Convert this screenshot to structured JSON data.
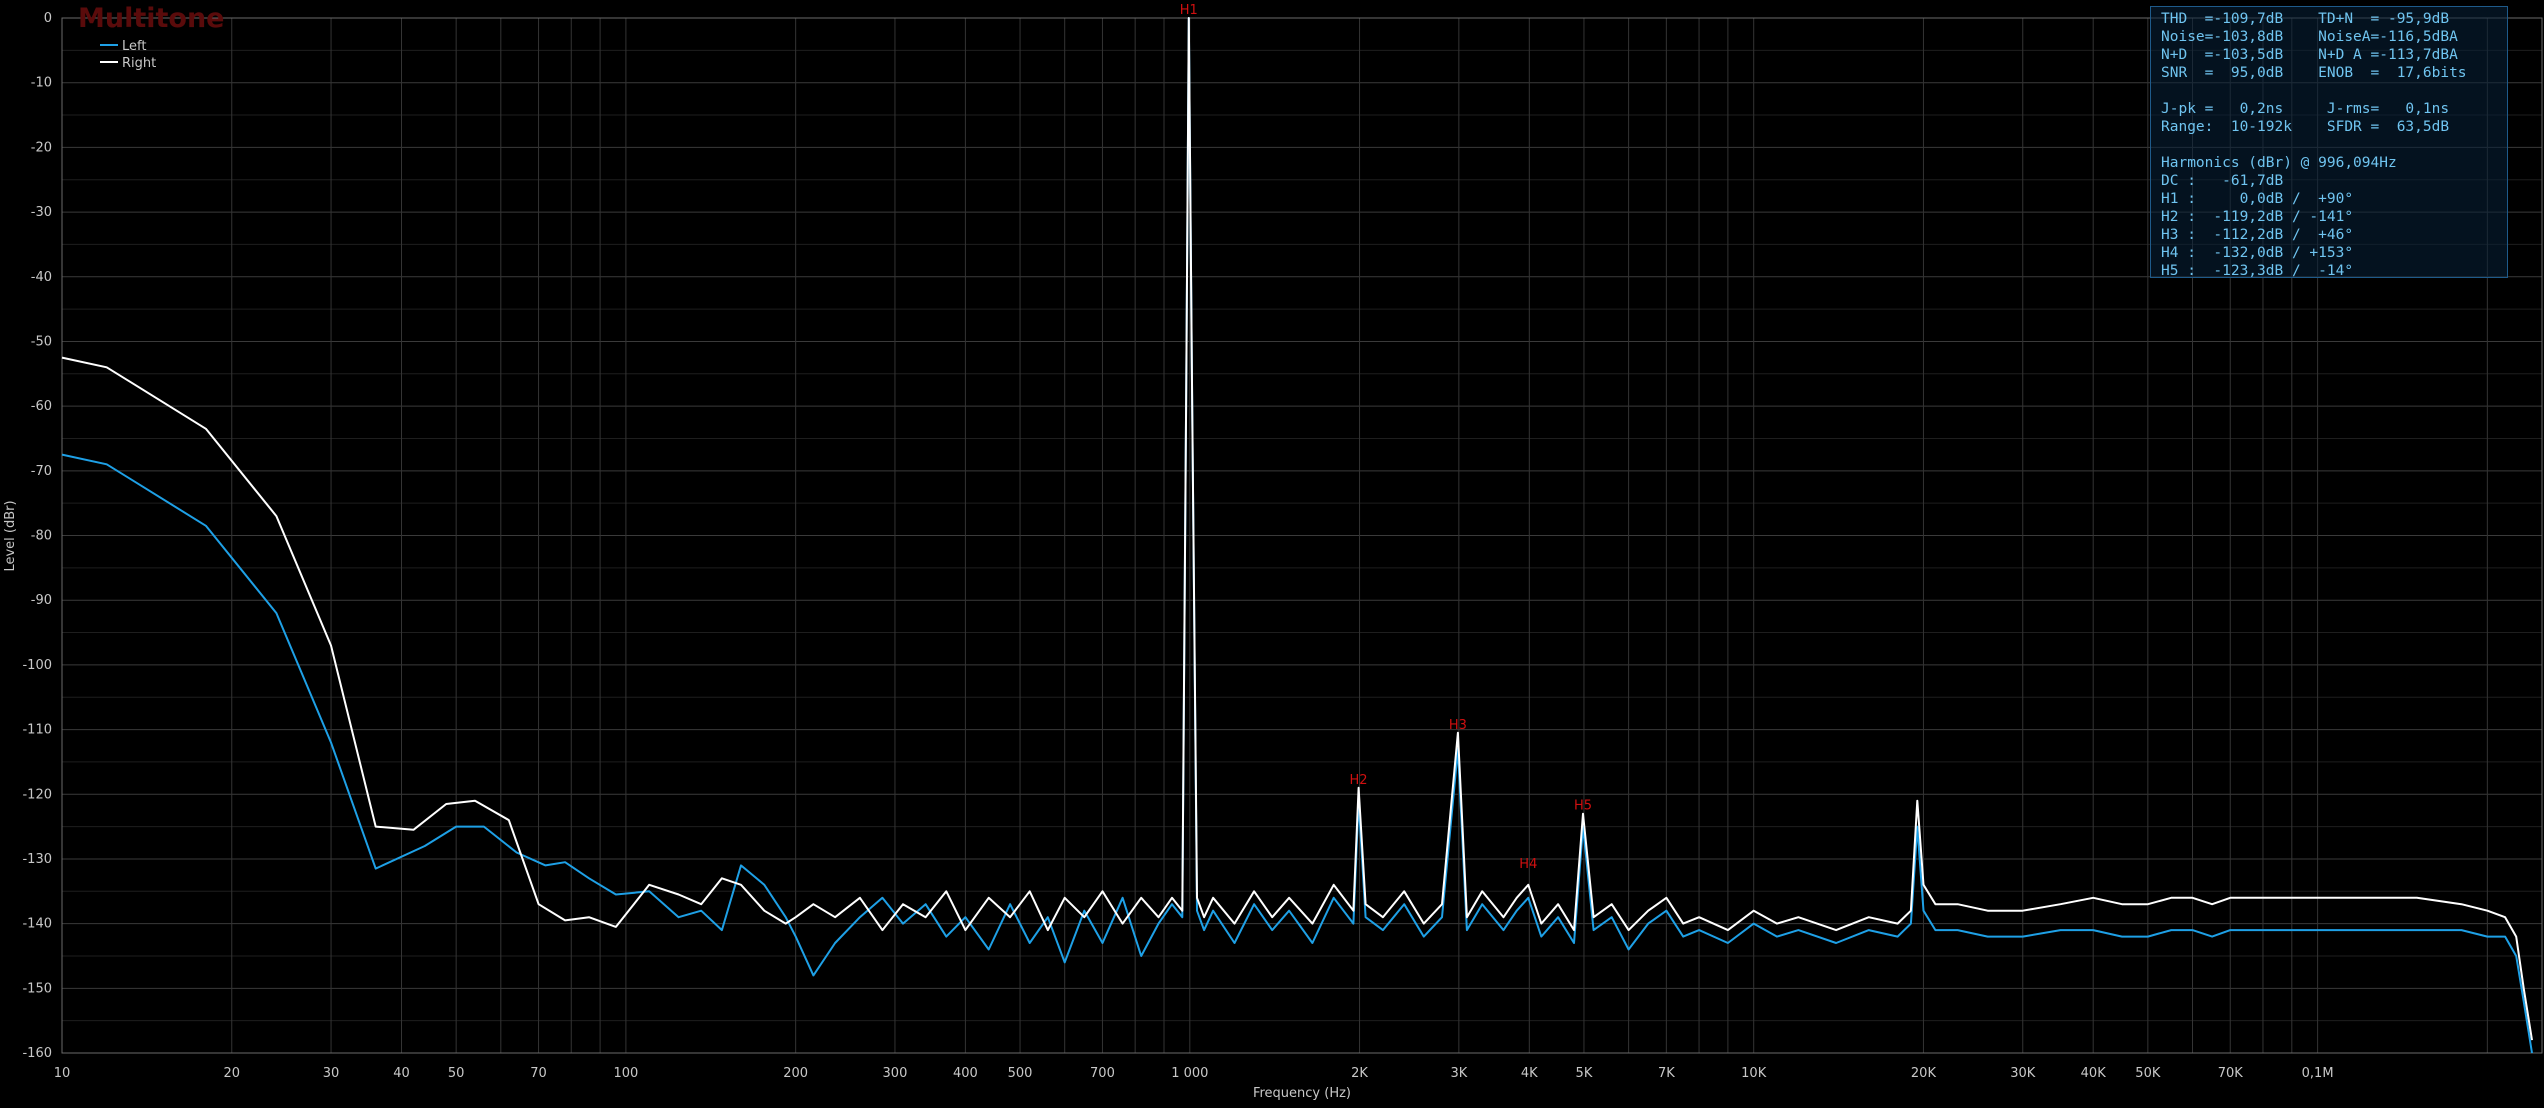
{
  "brand": "Multitone",
  "chart_data": {
    "type": "line",
    "xscale": "log",
    "xlim": [
      10,
      250000
    ],
    "ylim": [
      -160,
      0
    ],
    "xlabel": "Frequency (Hz)",
    "ylabel": "Level (dBr)",
    "grid": true,
    "legend_placement": "top-left",
    "y_ticks": [
      0,
      -10,
      -20,
      -30,
      -40,
      -50,
      -60,
      -70,
      -80,
      -90,
      -100,
      -110,
      -120,
      -130,
      -140,
      -150,
      -160
    ],
    "x_ticks": [
      {
        "value": 10,
        "label": "10"
      },
      {
        "value": 20,
        "label": "20"
      },
      {
        "value": 30,
        "label": "30"
      },
      {
        "value": 40,
        "label": "40"
      },
      {
        "value": 50,
        "label": "50"
      },
      {
        "value": 70,
        "label": "70"
      },
      {
        "value": 100,
        "label": "100"
      },
      {
        "value": 200,
        "label": "200"
      },
      {
        "value": 300,
        "label": "300"
      },
      {
        "value": 400,
        "label": "400"
      },
      {
        "value": 500,
        "label": "500"
      },
      {
        "value": 700,
        "label": "700"
      },
      {
        "value": 1000,
        "label": "1 000"
      },
      {
        "value": 2000,
        "label": "2K"
      },
      {
        "value": 3000,
        "label": "3K"
      },
      {
        "value": 4000,
        "label": "4K"
      },
      {
        "value": 5000,
        "label": "5K"
      },
      {
        "value": 7000,
        "label": "7K"
      },
      {
        "value": 10000,
        "label": "10K"
      },
      {
        "value": 20000,
        "label": "20K"
      },
      {
        "value": 30000,
        "label": "30K"
      },
      {
        "value": 40000,
        "label": "40K"
      },
      {
        "value": 50000,
        "label": "50K"
      },
      {
        "value": 70000,
        "label": "70K"
      },
      {
        "value": 100000,
        "label": "0,1M"
      }
    ],
    "series": [
      {
        "name": "Left",
        "color": "#1ea0e6",
        "x": [
          10,
          12,
          18,
          24,
          30,
          36,
          44,
          50,
          56,
          64,
          72,
          78,
          86,
          96,
          110,
          124,
          136,
          148,
          160,
          176,
          192,
          200,
          215,
          235,
          260,
          285,
          310,
          340,
          370,
          400,
          440,
          480,
          520,
          560,
          600,
          650,
          700,
          760,
          820,
          880,
          930,
          970,
          985,
          996,
          1010,
          1030,
          1060,
          1100,
          1200,
          1300,
          1400,
          1500,
          1650,
          1800,
          1950,
          1992,
          2050,
          2200,
          2400,
          2600,
          2800,
          2988,
          3100,
          3300,
          3600,
          3800,
          3984,
          4200,
          4500,
          4800,
          4980,
          5200,
          5600,
          6000,
          6500,
          7000,
          7500,
          8000,
          9000,
          10000,
          11000,
          12000,
          14000,
          16000,
          18000,
          19000,
          19500,
          20000,
          21000,
          23000,
          26000,
          30000,
          35000,
          40000,
          45000,
          50000,
          55000,
          60000,
          65000,
          70000,
          75000,
          80000,
          85000,
          90000,
          100000,
          120000,
          150000,
          180000,
          200000,
          215000,
          225000,
          232000,
          240000
        ],
        "y": [
          -67.5,
          -69,
          -78.5,
          -92,
          -112,
          -131.5,
          -128,
          -125,
          -125,
          -129,
          -131,
          -130.5,
          -133,
          -135.5,
          -135,
          -139,
          -138,
          -141,
          -131,
          -134,
          -139,
          -142,
          -148,
          -143,
          -139,
          -136,
          -140,
          -137,
          -142,
          -139,
          -144,
          -137,
          -143,
          -139,
          -146,
          -138,
          -143,
          -136,
          -145,
          -140,
          -137,
          -139,
          -60,
          0,
          -60,
          -138,
          -141,
          -138,
          -143,
          -137,
          -141,
          -138,
          -143,
          -136,
          -140,
          -121,
          -139,
          -141,
          -137,
          -142,
          -139,
          -113,
          -141,
          -137,
          -141,
          -138,
          -136,
          -142,
          -139,
          -143,
          -125,
          -141,
          -139,
          -144,
          -140,
          -138,
          -142,
          -141,
          -143,
          -140,
          -142,
          -141,
          -143,
          -141,
          -142,
          -140,
          -125,
          -138,
          -141,
          -141,
          -142,
          -142,
          -141,
          -141,
          -142,
          -142,
          -141,
          -141,
          -142,
          -141,
          -141,
          -141,
          -141,
          -141,
          -141,
          -141,
          -141,
          -141,
          -142,
          -142,
          -145,
          -152,
          -160
        ]
      },
      {
        "name": "Right",
        "color": "#ffffff",
        "x": [
          10,
          12,
          18,
          24,
          30,
          36,
          42,
          48,
          54,
          62,
          70,
          78,
          86,
          96,
          110,
          124,
          136,
          148,
          160,
          176,
          192,
          200,
          215,
          235,
          260,
          285,
          310,
          340,
          370,
          400,
          440,
          480,
          520,
          560,
          600,
          650,
          700,
          760,
          820,
          880,
          930,
          970,
          985,
          996,
          1010,
          1030,
          1060,
          1100,
          1200,
          1300,
          1400,
          1500,
          1650,
          1800,
          1950,
          1992,
          2050,
          2200,
          2400,
          2600,
          2800,
          2988,
          3100,
          3300,
          3600,
          3800,
          3984,
          4200,
          4500,
          4800,
          4980,
          5200,
          5600,
          6000,
          6500,
          7000,
          7500,
          8000,
          9000,
          10000,
          11000,
          12000,
          14000,
          16000,
          18000,
          19000,
          19500,
          20000,
          21000,
          23000,
          26000,
          30000,
          35000,
          40000,
          45000,
          50000,
          55000,
          60000,
          65000,
          70000,
          75000,
          80000,
          85000,
          90000,
          100000,
          120000,
          150000,
          180000,
          200000,
          215000,
          225000,
          232000,
          240000
        ],
        "y": [
          -52.5,
          -54,
          -63.5,
          -77,
          -97,
          -125,
          -125.5,
          -121.5,
          -121,
          -124,
          -137,
          -139.5,
          -139,
          -140.5,
          -134,
          -135.5,
          -137,
          -133,
          -134,
          -138,
          -140,
          -139,
          -137,
          -139,
          -136,
          -141,
          -137,
          -139,
          -135,
          -141,
          -136,
          -139,
          -135,
          -141,
          -136,
          -139,
          -135,
          -140,
          -136,
          -139,
          -136,
          -138,
          -60,
          0,
          -60,
          -136,
          -139,
          -136,
          -140,
          -135,
          -139,
          -136,
          -140,
          -134,
          -138,
          -119,
          -137,
          -139,
          -135,
          -140,
          -137,
          -110.5,
          -139,
          -135,
          -139,
          -136,
          -134,
          -140,
          -137,
          -141,
          -123,
          -139,
          -137,
          -141,
          -138,
          -136,
          -140,
          -139,
          -141,
          -138,
          -140,
          -139,
          -141,
          -139,
          -140,
          -138,
          -121,
          -134,
          -137,
          -137,
          -138,
          -138,
          -137,
          -136,
          -137,
          -137,
          -136,
          -136,
          -137,
          -136,
          -136,
          -136,
          -136,
          -136,
          -136,
          -136,
          -136,
          -137,
          -138,
          -139,
          -142,
          -150,
          -158
        ]
      }
    ],
    "annotations": [
      {
        "label": "H1",
        "x": 996,
        "y": 0
      },
      {
        "label": "H2",
        "x": 1992,
        "y": -119
      },
      {
        "label": "H3",
        "x": 2988,
        "y": -110.5
      },
      {
        "label": "H4",
        "x": 3984,
        "y": -132
      },
      {
        "label": "H5",
        "x": 4980,
        "y": -123
      }
    ]
  },
  "stats": {
    "lines": [
      "THD  =-109,7dB    TD+N  = -95,9dB",
      "Noise=-103,8dB    NoiseA=-116,5dBA",
      "N+D  =-103,5dB    N+D A =-113,7dBA",
      "SNR  =  95,0dB    ENOB  =  17,6bits",
      "",
      "J-pk =   0,2ns     J-rms=   0,1ns",
      "Range:  10-192k    SFDR =  63,5dB",
      "",
      "Harmonics (dBr) @ 996,094Hz",
      "DC :   -61,7dB",
      "H1 :     0,0dB /  +90°",
      "H2 :  -119,2dB / -141°",
      "H3 :  -112,2dB /  +46°",
      "H4 :  -132,0dB / +153°",
      "H5 :  -123,3dB /  -14°"
    ]
  }
}
